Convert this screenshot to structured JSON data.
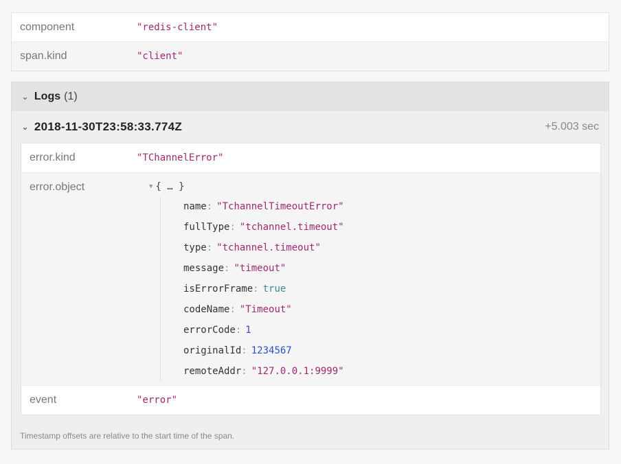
{
  "tags": [
    {
      "key": "component",
      "value": "\"redis-client\""
    },
    {
      "key": "span.kind",
      "value": "\"client\""
    }
  ],
  "logs": {
    "title": "Logs",
    "count": "(1)",
    "chevron": "chevron-down-icon",
    "item": {
      "timestamp": "2018-11-30T23:58:33.774Z",
      "offset": "+5.003 sec",
      "fields": {
        "kind_key": "error.kind",
        "kind_value": "\"TChannelError\"",
        "object_key": "error.object",
        "object_summary": "{ … }",
        "object_props": [
          {
            "key": "name",
            "value": "\"TchannelTimeoutError\"",
            "type": "string"
          },
          {
            "key": "fullType",
            "value": "\"tchannel.timeout\"",
            "type": "string"
          },
          {
            "key": "type",
            "value": "\"tchannel.timeout\"",
            "type": "string"
          },
          {
            "key": "message",
            "value": "\"timeout\"",
            "type": "string"
          },
          {
            "key": "isErrorFrame",
            "value": "true",
            "type": "bool"
          },
          {
            "key": "codeName",
            "value": "\"Timeout\"",
            "type": "string"
          },
          {
            "key": "errorCode",
            "value": "1",
            "type": "number"
          },
          {
            "key": "originalId",
            "value": "1234567",
            "type": "number"
          },
          {
            "key": "remoteAddr",
            "value": "\"127.0.0.1:9999\"",
            "type": "string"
          }
        ],
        "event_key": "event",
        "event_value": "\"error\""
      }
    },
    "footer": "Timestamp offsets are relative to the start time of the span."
  },
  "colors": {
    "string": "#a1286f",
    "bool": "#3a8c8c",
    "number": "#2c4bd0"
  }
}
